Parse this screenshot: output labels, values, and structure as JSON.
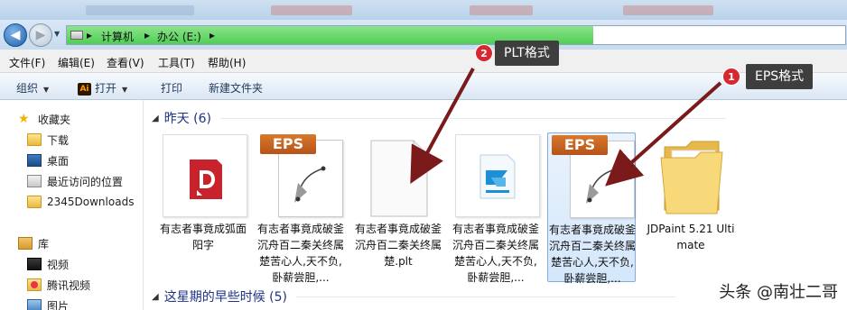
{
  "address": {
    "segments": [
      "计算机",
      "办公 (E:)"
    ]
  },
  "menu": [
    "文件(F)",
    "编辑(E)",
    "查看(V)",
    "工具(T)",
    "帮助(H)"
  ],
  "toolbar": {
    "organize": "组织",
    "open": "打开",
    "print": "打印",
    "new_folder": "新建文件夹",
    "open_icon_text": "Ai"
  },
  "nav": {
    "favorites": "收藏夹",
    "downloads": "下载",
    "desktop": "桌面",
    "recent": "最近访问的位置",
    "downloads2345": "2345Downloads",
    "library": "库",
    "video": "视频",
    "tencent_video": "腾讯视频",
    "pictures": "图片"
  },
  "groups": {
    "yesterday": "昨天 (6)",
    "this_week": "这星期的早些时候 (5)"
  },
  "files": [
    {
      "name": "有志者事竟成弧面阳字",
      "icon": "jdpaint-icon"
    },
    {
      "name": "有志者事竟成破釜沉舟百二秦关终属楚苦心人,天不负,卧薪尝胆,...",
      "icon": "eps-icon",
      "tag": "EPS"
    },
    {
      "name": "有志者事竟成破釜沉舟百二秦关终属楚.plt",
      "icon": "plt-icon"
    },
    {
      "name": "有志者事竟成破釜沉舟百二秦关终属楚苦心人,天不负,卧薪尝胆,...",
      "icon": "engrave-icon"
    },
    {
      "name": "有志者事竟成破釜沉舟百二秦关终属楚苦心人,天不负,卧薪尝胆,...",
      "icon": "eps-icon",
      "tag": "EPS"
    },
    {
      "name": "JDPaint 5.21 Ultimate",
      "icon": "folder-icon"
    }
  ],
  "callouts": {
    "plt": {
      "badge": "2",
      "label": "PLT格式"
    },
    "eps": {
      "badge": "1",
      "label": "EPS格式"
    }
  },
  "watermark": "头条 @南壮二哥",
  "colors": {
    "accent": "#1e3287",
    "path_fill": "#4fcf55",
    "badge": "#d7282f",
    "eps_tag": "#c4621f",
    "arrow": "#7a1a1a"
  }
}
